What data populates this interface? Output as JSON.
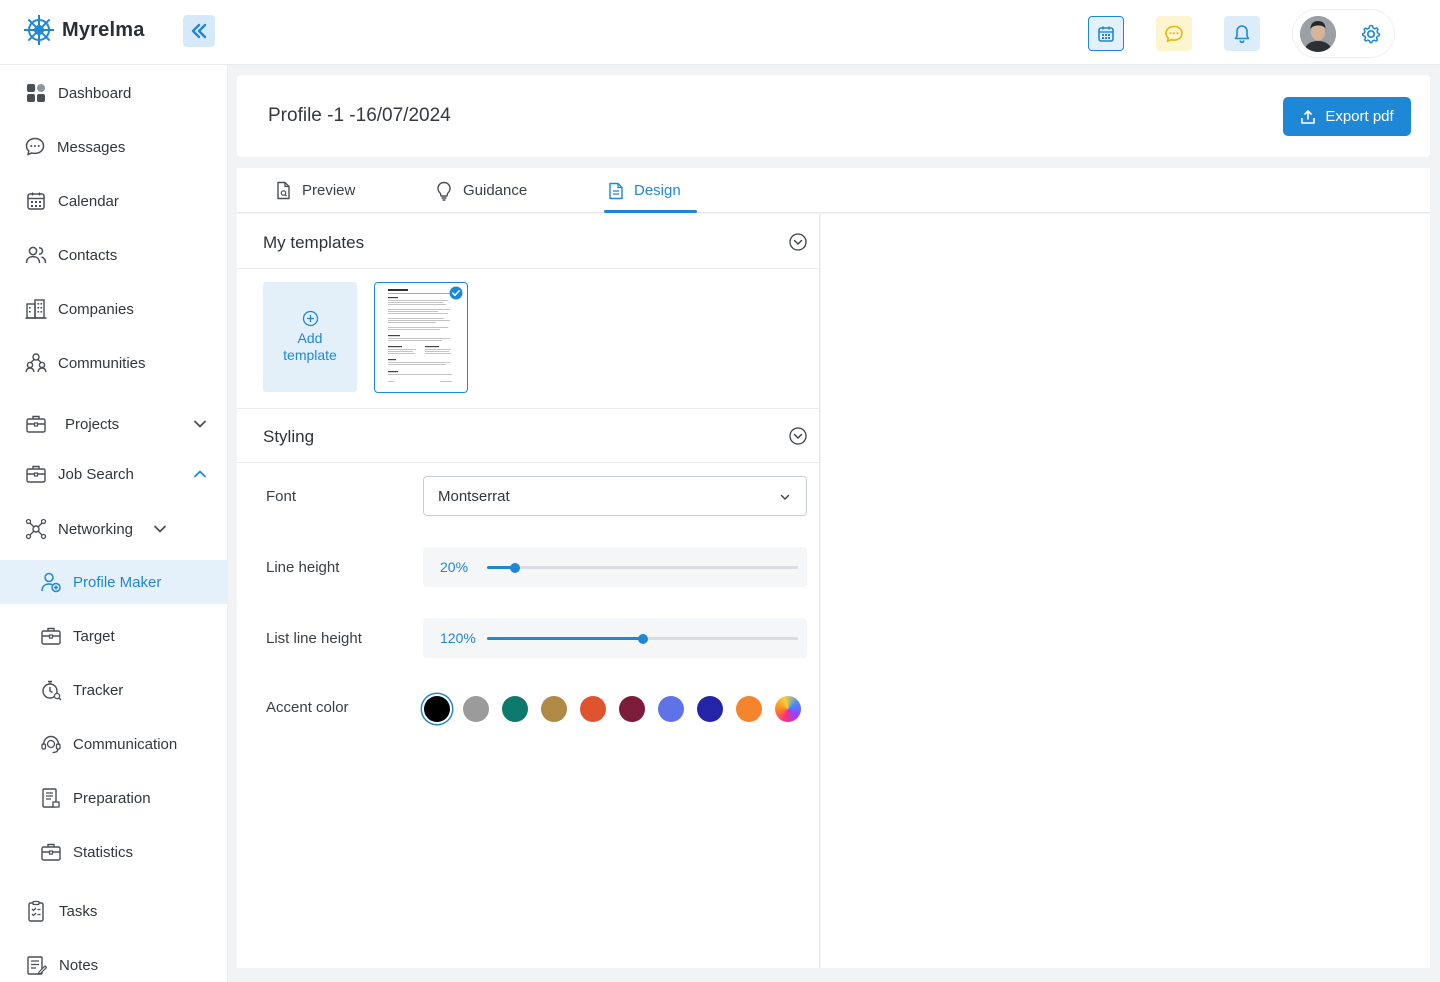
{
  "app": {
    "name": "Myrelma"
  },
  "sidebar": {
    "items": [
      {
        "label": "Dashboard",
        "icon": "grid-icon"
      },
      {
        "label": "Messages",
        "icon": "chat-icon"
      },
      {
        "label": "Calendar",
        "icon": "calendar-icon"
      },
      {
        "label": "Contacts",
        "icon": "users-icon"
      },
      {
        "label": "Companies",
        "icon": "building-icon"
      },
      {
        "label": "Communities",
        "icon": "community-icon"
      },
      {
        "label": "Projects",
        "icon": "briefcase-icon",
        "expanded": false
      },
      {
        "label": "Job Search",
        "icon": "briefcase-icon",
        "expanded": true
      },
      {
        "label": "Networking",
        "icon": "network-icon",
        "expanded": false
      },
      {
        "label": "Profile Maker",
        "icon": "profile-icon",
        "active": true
      },
      {
        "label": "Target",
        "icon": "briefcase-icon"
      },
      {
        "label": "Tracker",
        "icon": "stopwatch-icon"
      },
      {
        "label": "Communication",
        "icon": "headset-icon"
      },
      {
        "label": "Preparation",
        "icon": "document-icon"
      },
      {
        "label": "Statistics",
        "icon": "briefcase-icon"
      },
      {
        "label": "Tasks",
        "icon": "clipboard-icon"
      },
      {
        "label": "Notes",
        "icon": "notes-icon"
      }
    ]
  },
  "page": {
    "title": "Profile -1 -16/07/2024",
    "export_label": "Export pdf"
  },
  "tabs": [
    {
      "label": "Preview",
      "active": false
    },
    {
      "label": "Guidance",
      "active": false
    },
    {
      "label": "Design",
      "active": true
    }
  ],
  "templates": {
    "title": "My templates",
    "add_line1": "Add",
    "add_line2": "template"
  },
  "styling": {
    "title": "Styling",
    "font_label": "Font",
    "font_value": "Montserrat",
    "line_height_label": "Line height",
    "line_height_value": "20%",
    "line_height_fraction": 0.09,
    "list_line_height_label": "List line height",
    "list_line_height_value": "120%",
    "list_line_height_fraction": 0.5,
    "accent_label": "Accent color",
    "accent_colors": [
      "#000000",
      "#9b9b9b",
      "#0b7a6c",
      "#b08a45",
      "#e0532f",
      "#7a1c3a",
      "#5f72e8",
      "#2324a7",
      "#f5842c",
      "gradient"
    ],
    "accent_selected_index": 0
  },
  "colors": {
    "primary": "#1e88d6",
    "active_bg": "#e4f0fa"
  }
}
